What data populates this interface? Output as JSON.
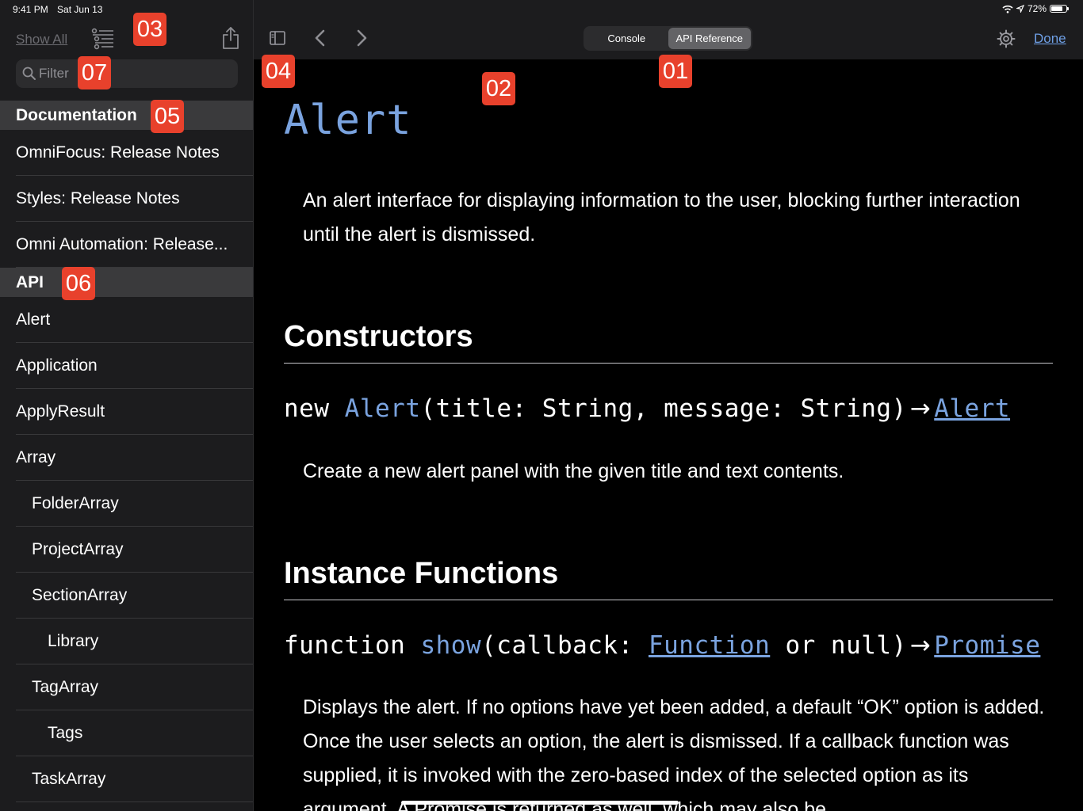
{
  "status_bar": {
    "time": "9:41 PM",
    "date": "Sat Jun 13",
    "battery": "72%"
  },
  "sidebar": {
    "show_all_label": "Show All",
    "filter_placeholder": "Filter",
    "documentation_header": "Documentation",
    "documentation_items": [
      {
        "label": "OmniFocus: Release Notes"
      },
      {
        "label": "Styles: Release Notes"
      },
      {
        "label": "Omni Automation: Release..."
      }
    ],
    "api_header": "API",
    "api_items": [
      {
        "label": "Alert",
        "indent": 0
      },
      {
        "label": "Application",
        "indent": 0
      },
      {
        "label": "ApplyResult",
        "indent": 0
      },
      {
        "label": "Array",
        "indent": 0
      },
      {
        "label": "FolderArray",
        "indent": 1
      },
      {
        "label": "ProjectArray",
        "indent": 1
      },
      {
        "label": "SectionArray",
        "indent": 1
      },
      {
        "label": "Library",
        "indent": 2
      },
      {
        "label": "TagArray",
        "indent": 1
      },
      {
        "label": "Tags",
        "indent": 2
      },
      {
        "label": "TaskArray",
        "indent": 1
      }
    ]
  },
  "toolbar": {
    "tabs": [
      {
        "label": "Console",
        "active": false
      },
      {
        "label": "API Reference",
        "active": true
      }
    ],
    "done_label": "Done"
  },
  "content": {
    "title": "Alert",
    "intro": "An alert interface for displaying information to the user, blocking further interaction until the alert is dismissed.",
    "constructors_heading": "Constructors",
    "constructor_sig": {
      "keyword": "new",
      "name": "Alert",
      "params": "(title: String, message: String)",
      "arrow": "→",
      "return_type": "Alert"
    },
    "constructor_desc": "Create a new alert panel with the given title and text contents.",
    "instance_heading": "Instance Functions",
    "show_sig": {
      "keyword": "function",
      "name": "show",
      "params_open": "(callback:",
      "param_type": "Function",
      "params_close": "or null)",
      "arrow": "→",
      "return_type": "Promise"
    },
    "show_desc": "Displays the alert. If no options have yet been added, a default “OK” option is added. Once the user selects an option, the alert is dismissed. If a callback function was supplied, it is invoked with the zero-based index of the selected option as its argument. A Promise is returned as well, which may also be"
  },
  "badges": {
    "b01": "01",
    "b02": "02",
    "b03": "03",
    "b04": "04",
    "b05": "05",
    "b06": "06",
    "b07": "07"
  },
  "colors": {
    "accent": "#7aa3df",
    "badge": "#e8412c",
    "sidebar_bg": "#1c1c1e",
    "section_bg": "#3a3a3c"
  },
  "icons": [
    "sidebar-toggle-icon",
    "back-chevron-icon",
    "forward-chevron-icon",
    "list-settings-icon",
    "share-icon",
    "search-icon",
    "gear-icon",
    "wifi-icon",
    "location-icon",
    "battery-icon"
  ]
}
